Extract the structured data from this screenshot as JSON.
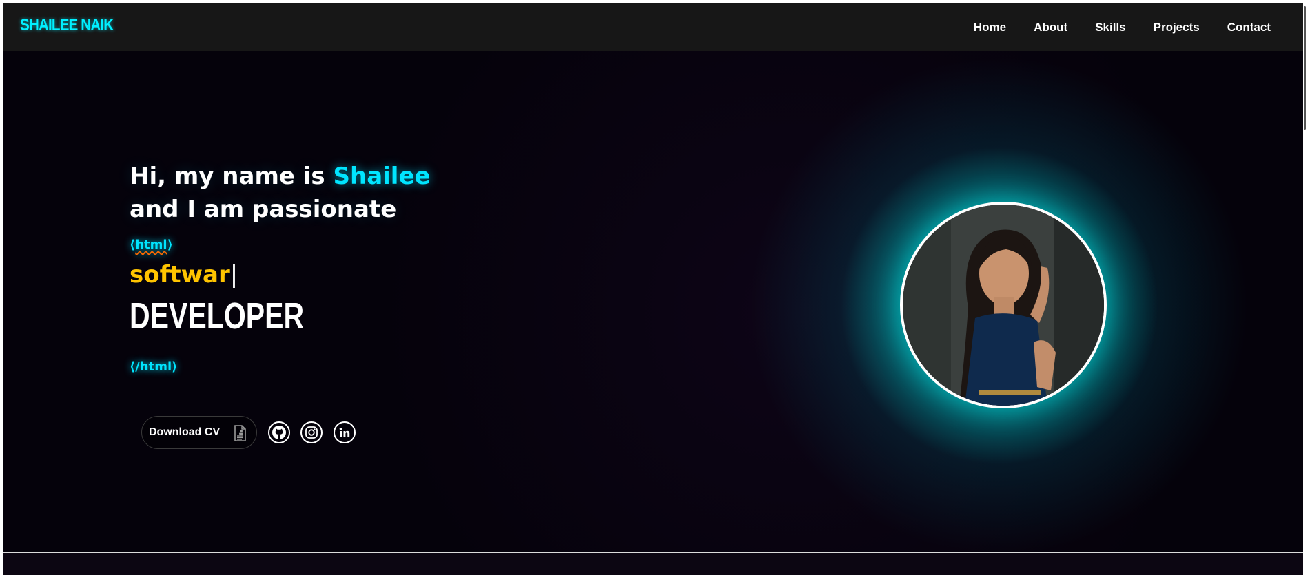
{
  "navbar": {
    "brand": "SHAILEE NAIK",
    "links": [
      "Home",
      "About",
      "Skills",
      "Projects",
      "Contact"
    ]
  },
  "hero": {
    "greeting_prefix": "Hi, my name is ",
    "greeting_name": "Shailee",
    "greeting_line2": "and I am passionate",
    "html_open_left": "⟨",
    "html_open_word": "html",
    "html_open_right": "⟩",
    "typed_text": "softwar",
    "cursor": "|",
    "role": "DEVELOPER",
    "html_close": "⟨/html⟩",
    "download_cv_label": "Download CV"
  },
  "social_icons": [
    "github-icon",
    "instagram-icon",
    "linkedin-icon"
  ],
  "colors": {
    "accent_cyan": "#00e5ff",
    "accent_yellow": "#ffc400",
    "background": "#05020b",
    "navbar": "#171717"
  }
}
